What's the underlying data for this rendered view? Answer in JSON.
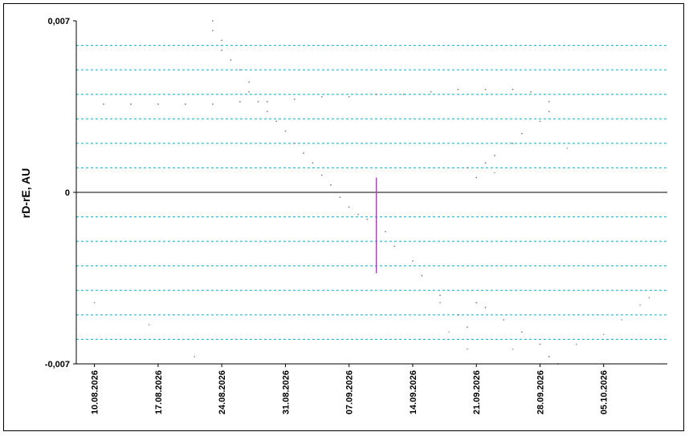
{
  "chart_data": {
    "type": "scatter",
    "title": "",
    "xlabel": "",
    "ylabel": "rD-rE, AU",
    "x_range": [
      "2026-08-08",
      "2026-10-12"
    ],
    "ylim": [
      -0.007,
      0.007
    ],
    "y_tick_labels": [
      "0,007",
      "0",
      "-0,007"
    ],
    "x_tick_labels": [
      "10.08.2026",
      "17.08.2026",
      "24.08.2026",
      "31.08.2026",
      "07.09.2026",
      "14.09.2026",
      "21.09.2026",
      "28.09.2026",
      "05.10.2026"
    ],
    "x_tick_dates": [
      "2026-08-10",
      "2026-08-17",
      "2026-08-24",
      "2026-08-31",
      "2026-09-07",
      "2026-09-14",
      "2026-09-21",
      "2026-09-28",
      "2026-10-05"
    ],
    "grid": {
      "horizontal": true,
      "style": "dashed",
      "color": "#00b0c8",
      "step": 0.001
    },
    "zero_line": true,
    "marker_line": {
      "date": "2026-09-10",
      "y_from": -0.0033,
      "y_to": 0.0006,
      "color": "#b040c0"
    },
    "series": [
      {
        "color": "#808080",
        "points": [
          [
            "2026-08-23",
            0.007
          ],
          [
            "2026-08-23",
            0.0066
          ],
          [
            "2026-08-24",
            0.0062
          ],
          [
            "2026-08-24",
            0.0058
          ],
          [
            "2026-08-25",
            0.0054
          ],
          [
            "2026-08-26",
            0.005
          ],
          [
            "2026-08-27",
            0.0045
          ],
          [
            "2026-08-27",
            0.0041
          ],
          [
            "2026-08-28",
            0.0037
          ],
          [
            "2026-08-29",
            0.0033
          ],
          [
            "2026-08-30",
            0.0029
          ],
          [
            "2026-08-31",
            0.0025
          ],
          [
            "2026-09-01",
            0.002
          ],
          [
            "2026-09-02",
            0.0016
          ],
          [
            "2026-09-03",
            0.0012
          ],
          [
            "2026-09-04",
            0.0007
          ],
          [
            "2026-09-05",
            0.0003
          ],
          [
            "2026-09-06",
            -0.0002
          ],
          [
            "2026-09-07",
            -0.0006
          ],
          [
            "2026-09-08",
            -0.0009
          ],
          [
            "2026-09-09",
            -0.0011
          ],
          [
            "2026-09-10",
            -0.0012
          ],
          [
            "2026-09-11",
            -0.0016
          ],
          [
            "2026-09-12",
            -0.0022
          ],
          [
            "2026-09-14",
            -0.0028
          ],
          [
            "2026-09-15",
            -0.0034
          ],
          [
            "2026-09-17",
            -0.0042
          ],
          [
            "2026-09-19",
            -0.005
          ],
          [
            "2026-09-20",
            -0.0055
          ],
          [
            "2026-09-21",
            -0.0045
          ],
          [
            "2026-09-22",
            -0.0047
          ],
          [
            "2026-09-24",
            -0.0052
          ],
          [
            "2026-09-26",
            -0.0057
          ],
          [
            "2026-09-28",
            -0.0062
          ],
          [
            "2026-09-29",
            -0.0067
          ],
          [
            "2026-09-30",
            -0.007
          ]
        ]
      },
      {
        "color": "#808080",
        "points": [
          [
            "2026-08-11",
            0.0036
          ],
          [
            "2026-08-14",
            0.0036
          ],
          [
            "2026-08-17",
            0.0036
          ],
          [
            "2026-08-20",
            0.0036
          ],
          [
            "2026-08-23",
            0.0036
          ],
          [
            "2026-08-26",
            0.0037
          ],
          [
            "2026-08-29",
            0.0037
          ],
          [
            "2026-09-01",
            0.0038
          ],
          [
            "2026-09-04",
            0.0039
          ],
          [
            "2026-09-07",
            0.0039
          ],
          [
            "2026-09-10",
            0.004
          ],
          [
            "2026-09-13",
            0.004
          ],
          [
            "2026-09-16",
            0.0041
          ],
          [
            "2026-09-19",
            0.0042
          ],
          [
            "2026-09-22",
            0.0042
          ],
          [
            "2026-09-25",
            0.0042
          ],
          [
            "2026-09-27",
            0.0041
          ],
          [
            "2026-09-29",
            0.0037
          ],
          [
            "2026-09-29",
            0.0033
          ],
          [
            "2026-09-28",
            0.0029
          ],
          [
            "2026-09-26",
            0.0024
          ],
          [
            "2026-09-25",
            0.002
          ],
          [
            "2026-09-23",
            0.0015
          ],
          [
            "2026-09-22",
            0.0012
          ],
          [
            "2026-09-20",
            0.001
          ],
          [
            "2026-09-21",
            0.0006
          ]
        ]
      },
      {
        "color": "#a0a0a0",
        "points": [
          [
            "2026-08-10",
            -0.0045
          ],
          [
            "2026-08-16",
            -0.0054
          ],
          [
            "2026-08-21",
            -0.0067
          ],
          [
            "2026-09-17",
            -0.0045
          ],
          [
            "2026-09-18",
            -0.0057
          ],
          [
            "2026-09-20",
            -0.0064
          ],
          [
            "2026-09-25",
            -0.0064
          ],
          [
            "2026-10-02",
            -0.0062
          ],
          [
            "2026-10-05",
            -0.0058
          ],
          [
            "2026-10-07",
            -0.0052
          ],
          [
            "2026-10-09",
            -0.0046
          ],
          [
            "2026-10-10",
            -0.0043
          ],
          [
            "2026-10-01",
            0.0018
          ],
          [
            "2026-09-23",
            0.0008
          ]
        ]
      }
    ]
  }
}
